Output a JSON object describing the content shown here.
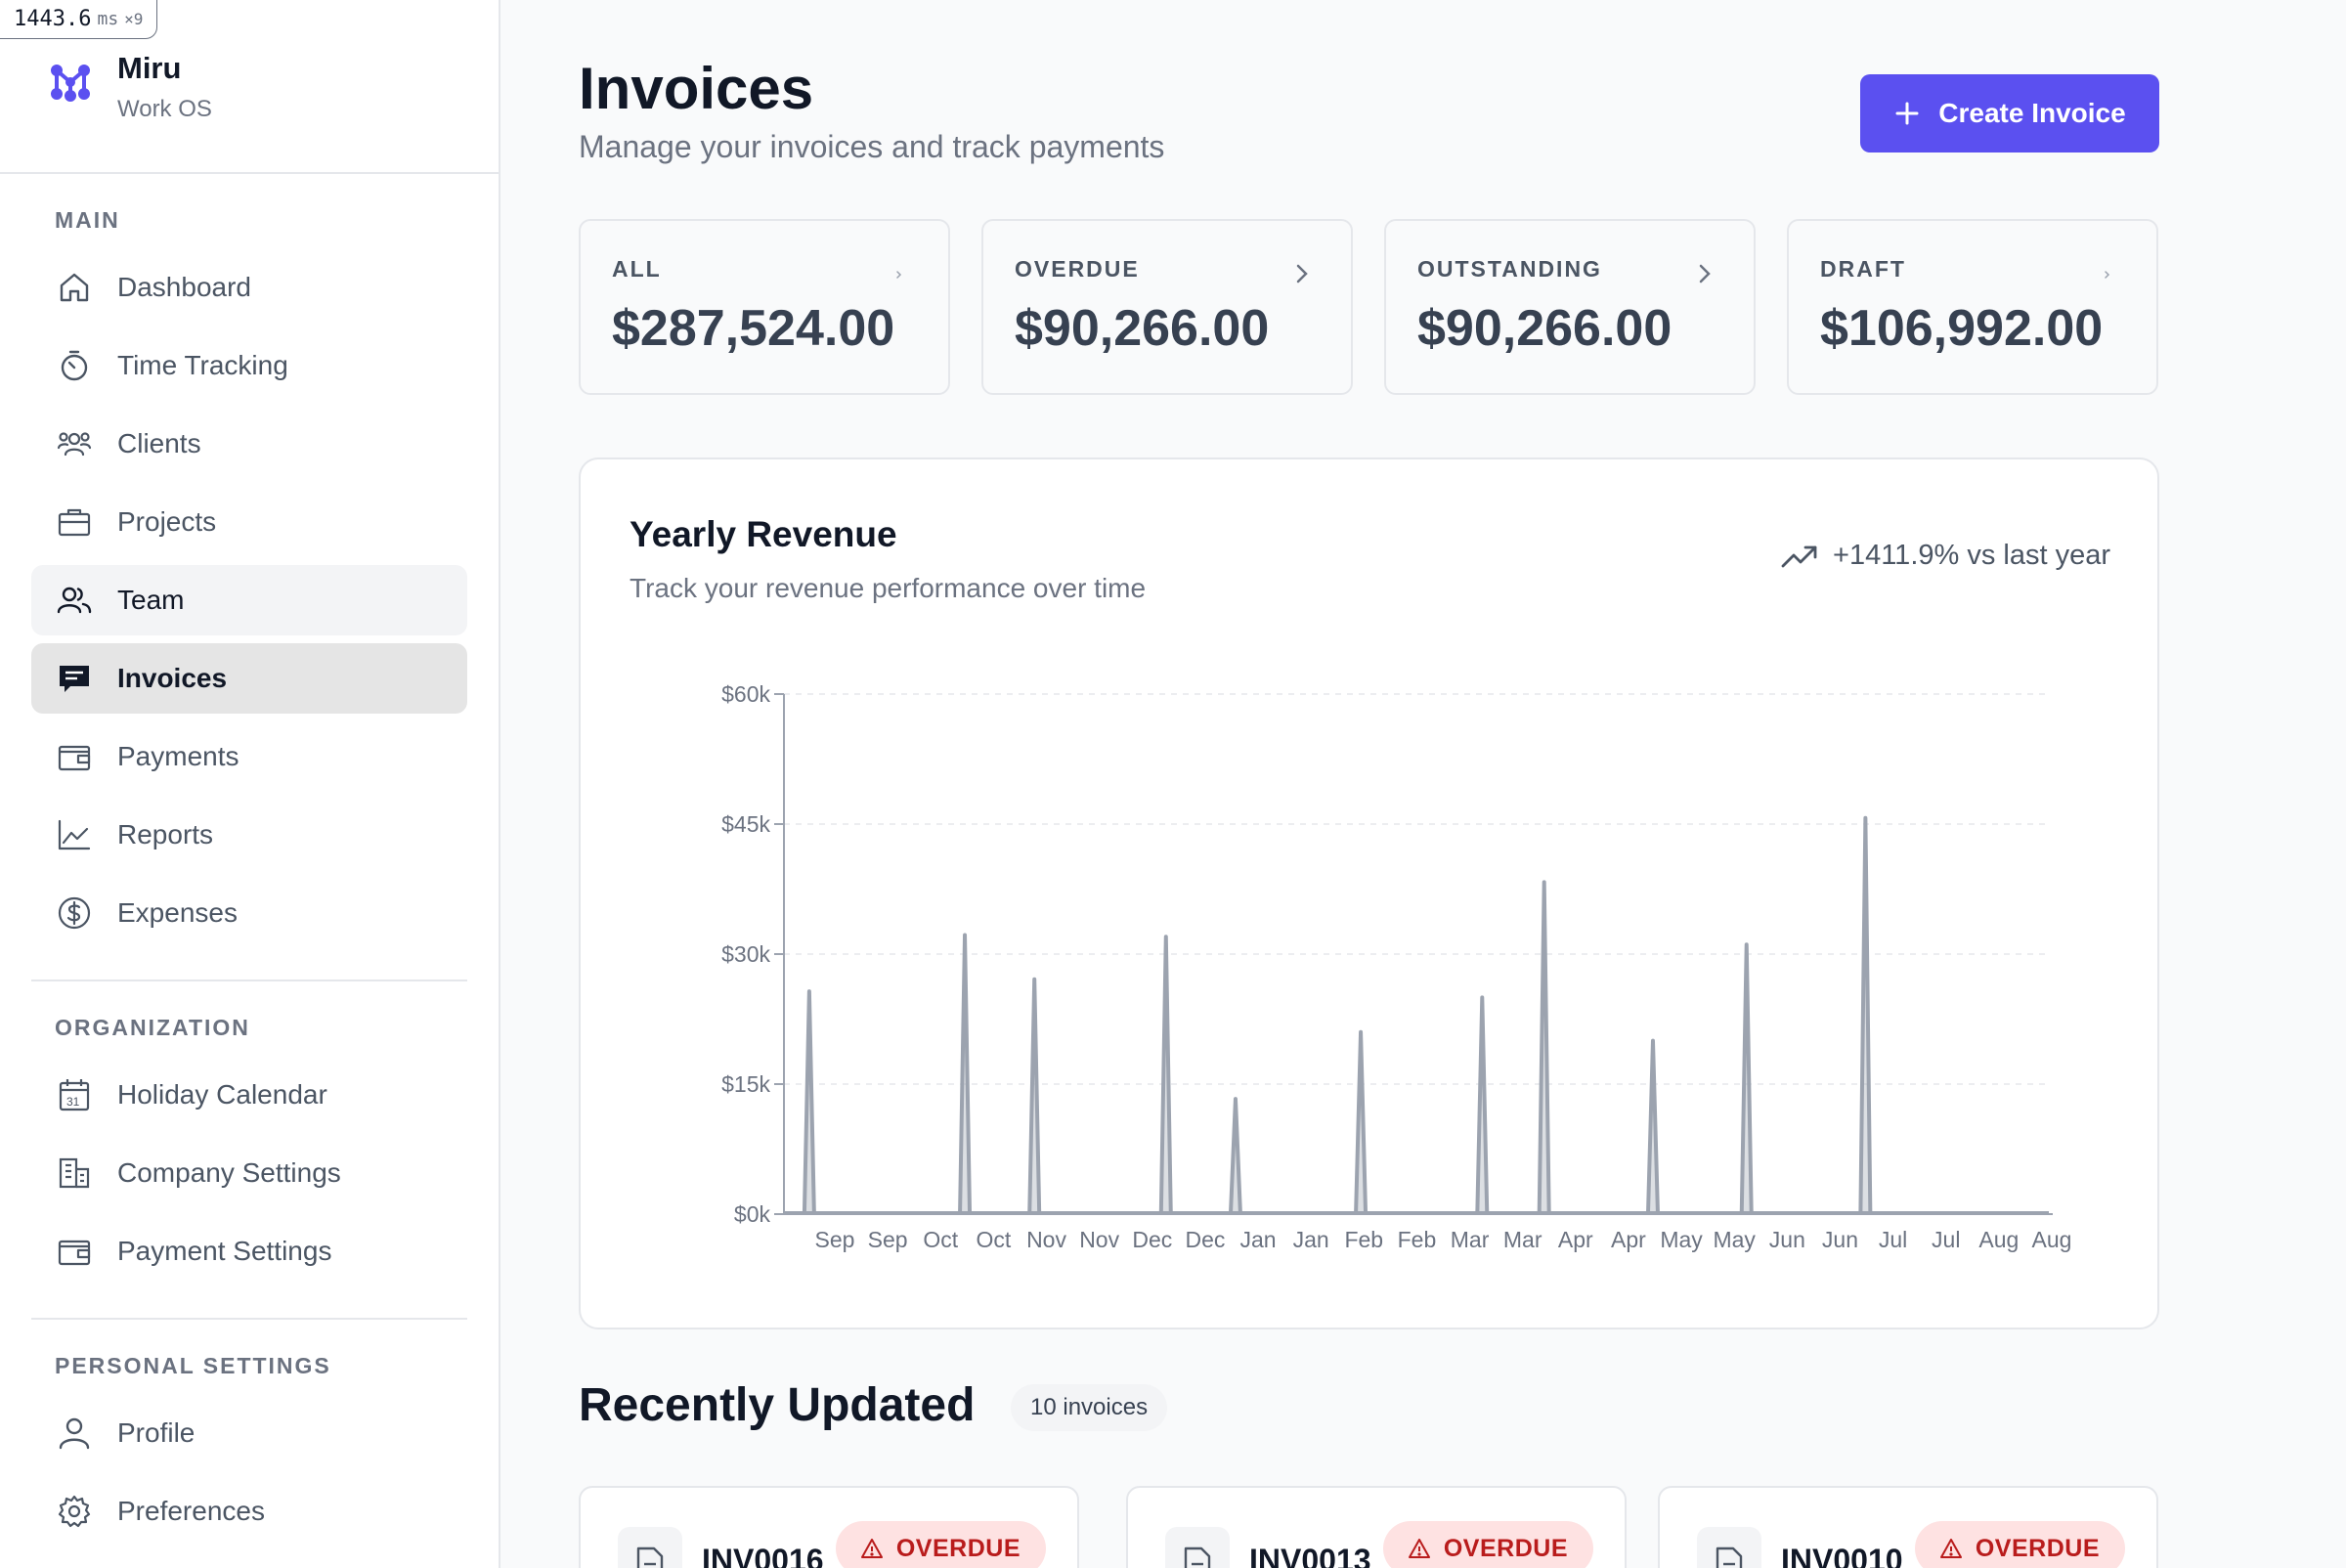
{
  "perf": {
    "value": "1443.6",
    "unit": "ms",
    "multiplier": "×9"
  },
  "brand": {
    "name": "Miru",
    "subtitle": "Work OS",
    "color": "#5b50f0"
  },
  "sidebar": {
    "sections": [
      {
        "label": "MAIN"
      },
      {
        "label": "ORGANIZATION"
      },
      {
        "label": "PERSONAL SETTINGS"
      }
    ],
    "main_items": [
      {
        "label": "Dashboard",
        "icon": "home-icon"
      },
      {
        "label": "Time Tracking",
        "icon": "stopwatch-icon"
      },
      {
        "label": "Clients",
        "icon": "users-group-icon"
      },
      {
        "label": "Projects",
        "icon": "briefcase-icon"
      },
      {
        "label": "Team",
        "icon": "team-icon",
        "state": "hover"
      },
      {
        "label": "Invoices",
        "icon": "invoice-icon",
        "state": "active"
      },
      {
        "label": "Payments",
        "icon": "wallet-icon"
      },
      {
        "label": "Reports",
        "icon": "line-chart-icon"
      },
      {
        "label": "Expenses",
        "icon": "dollar-circle-icon"
      }
    ],
    "org_items": [
      {
        "label": "Holiday Calendar",
        "icon": "calendar-icon"
      },
      {
        "label": "Company Settings",
        "icon": "building-icon"
      },
      {
        "label": "Payment Settings",
        "icon": "wallet-icon"
      }
    ],
    "personal_items": [
      {
        "label": "Profile",
        "icon": "user-icon"
      },
      {
        "label": "Preferences",
        "icon": "gear-icon"
      }
    ]
  },
  "header": {
    "title": "Invoices",
    "subtitle": "Manage your invoices and track payments",
    "create_button": "Create Invoice"
  },
  "stats": [
    {
      "label": "ALL",
      "value": "$287,524.00"
    },
    {
      "label": "OVERDUE",
      "value": "$90,266.00"
    },
    {
      "label": "OUTSTANDING",
      "value": "$90,266.00"
    },
    {
      "label": "DRAFT",
      "value": "$106,992.00"
    }
  ],
  "revenue": {
    "title": "Yearly Revenue",
    "subtitle": "Track your revenue performance over time",
    "trend": "+1411.9% vs last year"
  },
  "chart_data": {
    "type": "area",
    "title": "Yearly Revenue",
    "xlabel": "",
    "ylabel": "",
    "ylim": [
      0,
      60000
    ],
    "y_ticks": [
      "$0k",
      "$15k",
      "$30k",
      "$45k",
      "$60k"
    ],
    "y_tick_values": [
      0,
      15000,
      30000,
      45000,
      60000
    ],
    "x_ticks": [
      "Sep",
      "Sep",
      "Oct",
      "Oct",
      "Nov",
      "Nov",
      "Dec",
      "Dec",
      "Jan",
      "Jan",
      "Feb",
      "Feb",
      "Mar",
      "Mar",
      "Apr",
      "Apr",
      "May",
      "May",
      "Jun",
      "Jun",
      "Jul",
      "Jul",
      "Aug",
      "Aug"
    ],
    "x_range": [
      "Sep",
      "Aug"
    ],
    "series": [
      {
        "color": "#9ca3af",
        "spikes": [
          {
            "position": 0.02,
            "value": 25700
          },
          {
            "position": 0.143,
            "value": 32200
          },
          {
            "position": 0.198,
            "value": 27100
          },
          {
            "position": 0.302,
            "value": 32000
          },
          {
            "position": 0.357,
            "value": 13300
          },
          {
            "position": 0.456,
            "value": 21000
          },
          {
            "position": 0.552,
            "value": 25000
          },
          {
            "position": 0.601,
            "value": 38300
          },
          {
            "position": 0.687,
            "value": 20000
          },
          {
            "position": 0.761,
            "value": 31100
          },
          {
            "position": 0.855,
            "value": 45700
          }
        ]
      }
    ],
    "grid": true,
    "legend": "none"
  },
  "recent": {
    "title": "Recently Updated",
    "count": "10 invoices",
    "invoices": [
      {
        "id": "INV0016",
        "status": "OVERDUE"
      },
      {
        "id": "INV0013",
        "status": "OVERDUE"
      },
      {
        "id": "INV0010",
        "status": "OVERDUE"
      }
    ]
  }
}
